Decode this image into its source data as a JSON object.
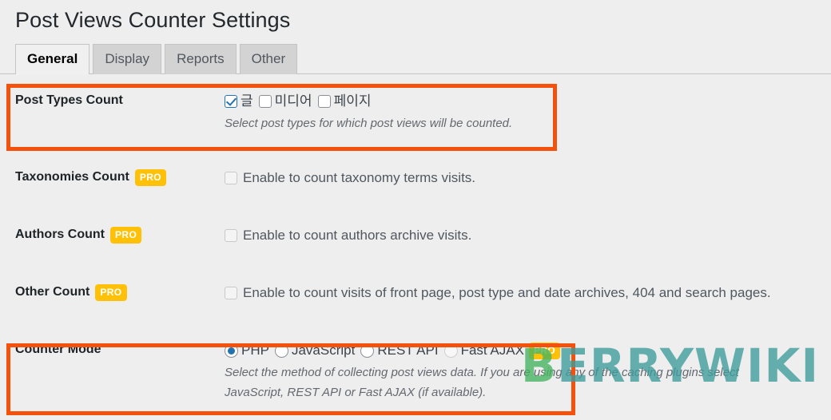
{
  "page": {
    "title": "Post Views Counter Settings"
  },
  "tabs": [
    {
      "label": "General",
      "active": true
    },
    {
      "label": "Display",
      "active": false
    },
    {
      "label": "Reports",
      "active": false
    },
    {
      "label": "Other",
      "active": false
    }
  ],
  "rows": {
    "post_types": {
      "label": "Post Types Count",
      "pro": false,
      "options": [
        {
          "label": "글",
          "checked": true
        },
        {
          "label": "미디어",
          "checked": false
        },
        {
          "label": "페이지",
          "checked": false
        }
      ],
      "description": "Select post types for which post views will be counted."
    },
    "taxonomies": {
      "label": "Taxonomies Count",
      "pro_badge": "PRO",
      "checkbox_label": "Enable to count taxonomy terms visits.",
      "checked": false
    },
    "authors": {
      "label": "Authors Count",
      "pro_badge": "PRO",
      "checkbox_label": "Enable to count authors archive visits.",
      "checked": false
    },
    "other": {
      "label": "Other Count",
      "pro_badge": "PRO",
      "checkbox_label": "Enable to count visits of front page, post type and date archives, 404 and search pages.",
      "checked": false
    },
    "counter_mode": {
      "label": "Counter Mode",
      "options": [
        {
          "label": "PHP",
          "selected": true,
          "disabled": false
        },
        {
          "label": "JavaScript",
          "selected": false,
          "disabled": false
        },
        {
          "label": "REST API",
          "selected": false,
          "disabled": false
        },
        {
          "label": "Fast AJAX",
          "selected": false,
          "disabled": true,
          "pro_badge": "PRO"
        }
      ],
      "description_line_1": "Select the method of collecting post views data. If you are using any of the caching plugins select",
      "description_line_2": "JavaScript, REST API or Fast AJAX (if available)."
    }
  },
  "watermark": {
    "first": "B",
    "rest": "ERRYWIKI",
    "first_color": "#45b45f",
    "rest_color": "#3d9c9c"
  },
  "colors": {
    "highlight_border": "#f4510c",
    "pro_badge_bg": "#ffc107",
    "accent": "#2271b1",
    "page_background": "#eeeeee"
  }
}
